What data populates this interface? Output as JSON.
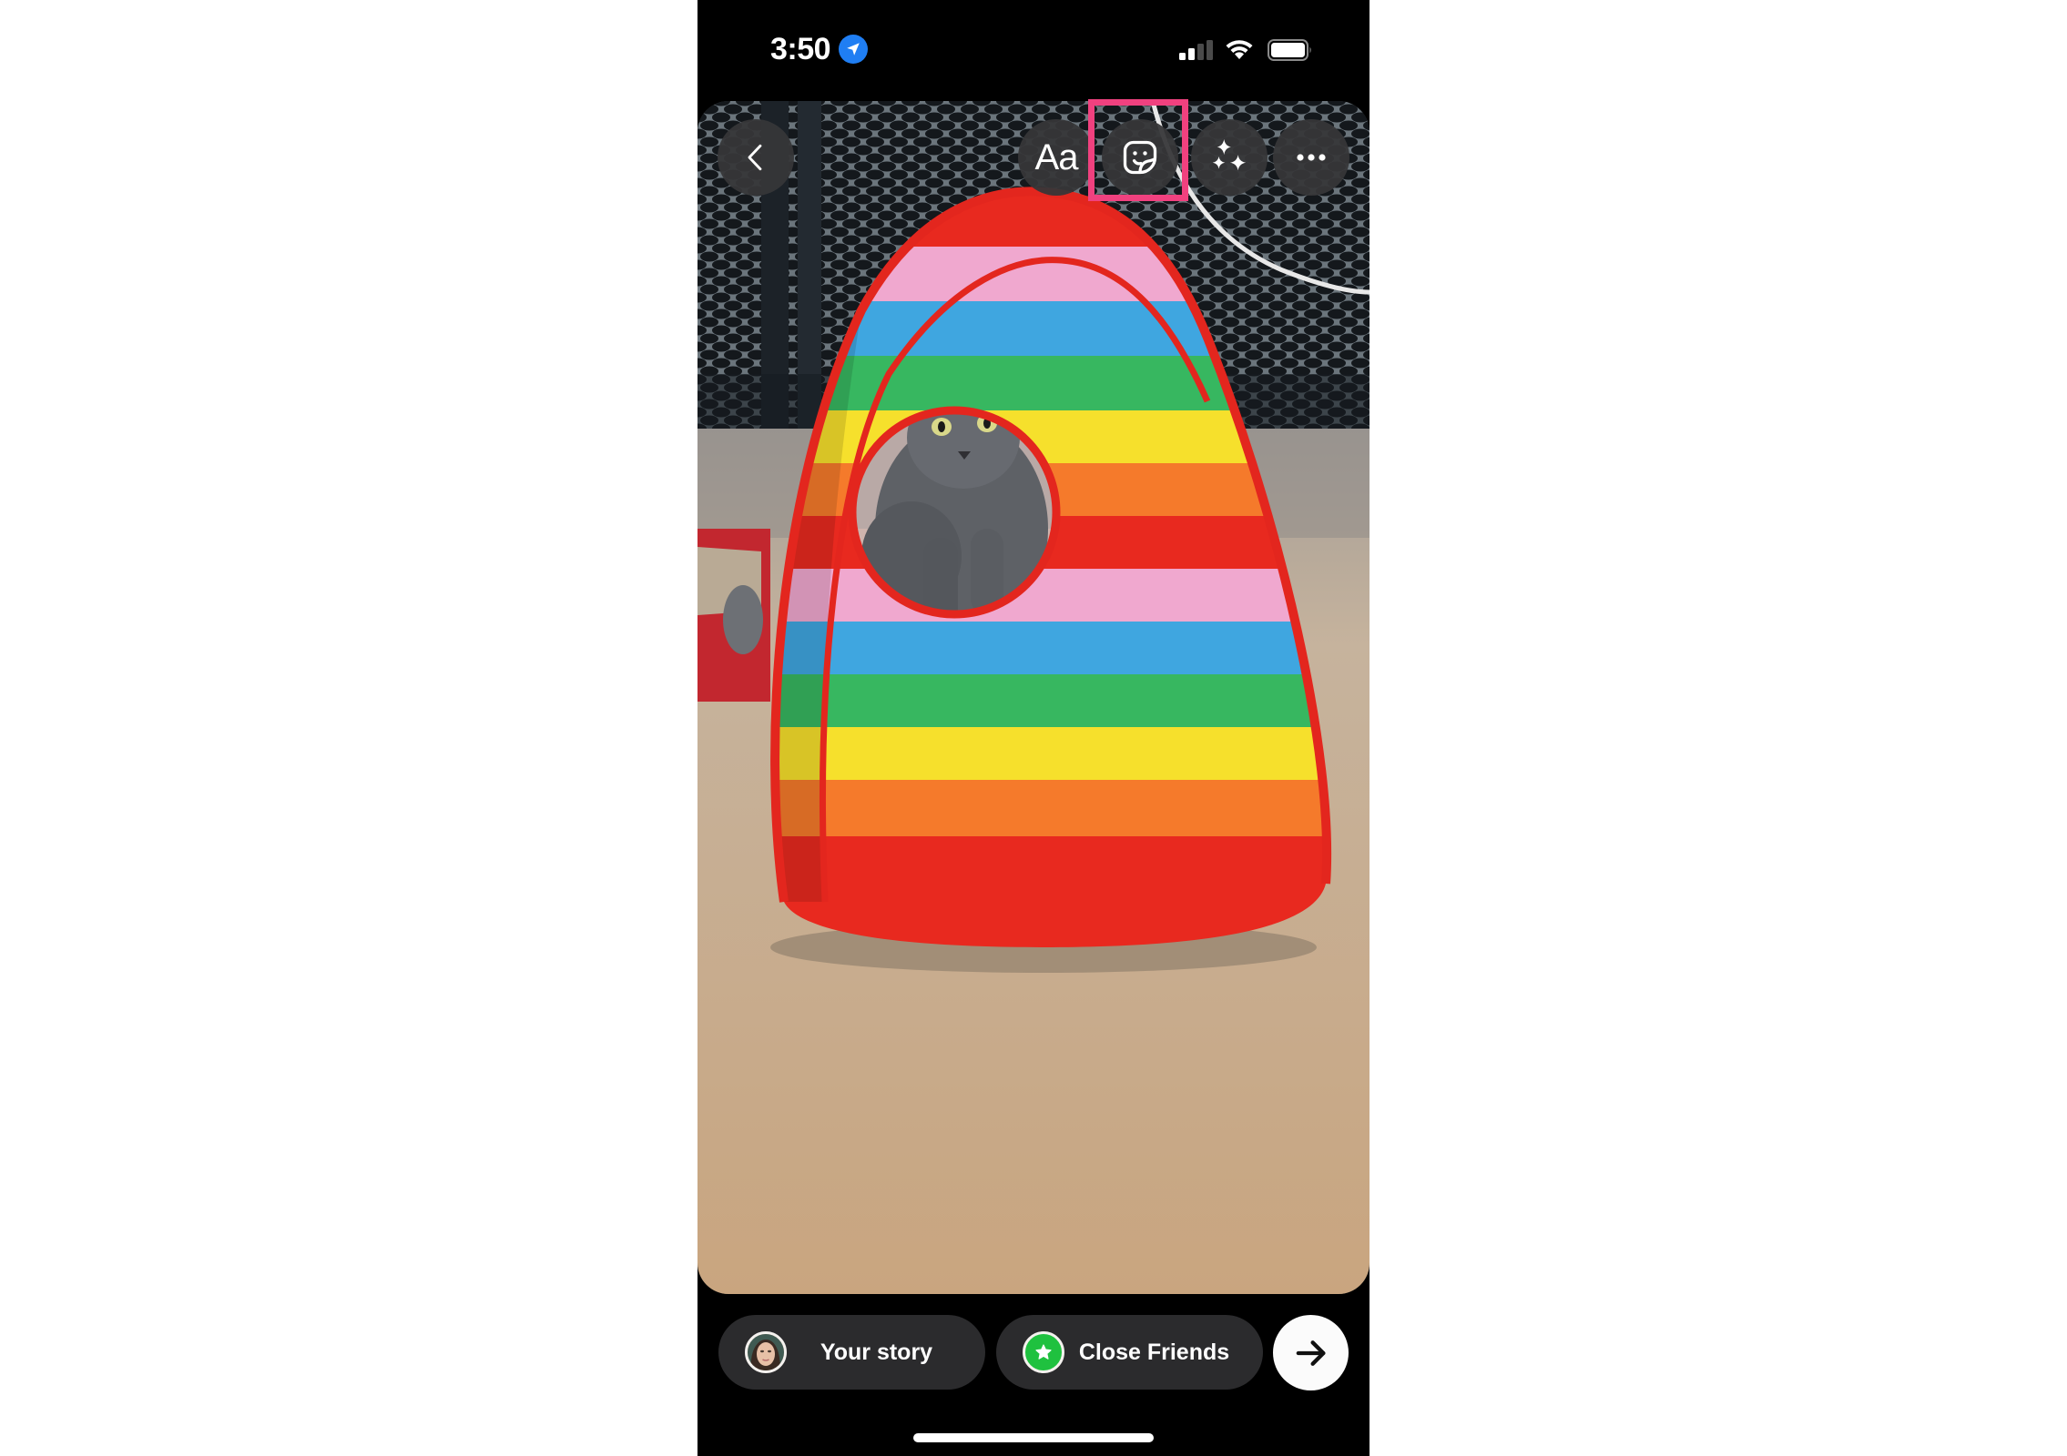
{
  "status_bar": {
    "time": "3:50",
    "location_icon": "location-arrow-icon",
    "signal_bars_filled": 2,
    "signal_bars_total": 4,
    "wifi_icon": "wifi-icon",
    "battery_icon": "battery-icon"
  },
  "photo": {
    "description": "Gray cat peeking out of a rainbow-striped pop-up tent on beige carpet",
    "stripe_colors": [
      "#f0a8cf",
      "#3fa6e0",
      "#37b760",
      "#f6e02c",
      "#f57a2b",
      "#e8291f"
    ]
  },
  "toolbar": {
    "back_icon": "chevron-left-icon",
    "text_label": "Aa",
    "sticker_icon": "sticker-icon",
    "effects_icon": "sparkles-icon",
    "more_icon": "more-horizontal-icon"
  },
  "highlight": {
    "target": "sticker-button",
    "color": "#f0417f"
  },
  "share_bar": {
    "your_story_label": "Your story",
    "close_friends_label": "Close Friends",
    "close_friends_color": "#1fc13f",
    "next_icon": "arrow-right-icon"
  }
}
